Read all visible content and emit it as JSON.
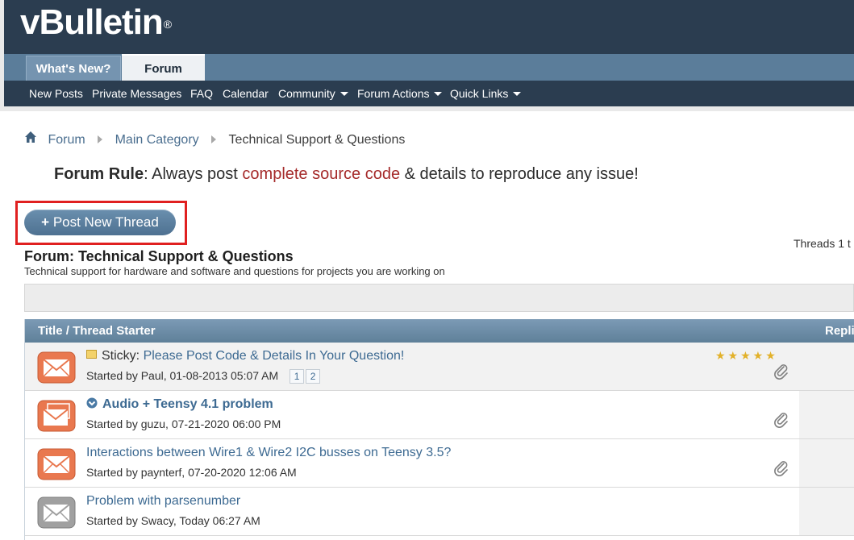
{
  "header": {
    "logo_text": "vBulletin",
    "logo_reg": "®",
    "tabs": [
      {
        "label": "What's New?"
      },
      {
        "label": "Forum"
      }
    ],
    "nav": {
      "new_posts": "New Posts",
      "private_messages": "Private Messages",
      "faq": "FAQ",
      "calendar": "Calendar",
      "community": "Community",
      "forum_actions": "Forum Actions",
      "quick_links": "Quick Links"
    }
  },
  "breadcrumb": {
    "items": [
      "Forum",
      "Main Category",
      "Technical Support & Questions"
    ]
  },
  "forum_rule": {
    "label": "Forum Rule",
    "pre": ": Always post ",
    "highlight": "complete source code",
    "post": " & details to reproduce any issue!"
  },
  "post_button": {
    "label": "Post New Thread"
  },
  "threads_count": "Threads 1 t",
  "forum": {
    "title": "Forum: Technical Support & Questions",
    "description": "Technical support for hardware and software and questions for projects you are working on"
  },
  "table": {
    "col_title": "Title / Thread Starter",
    "col_replies": "Repli"
  },
  "threads": [
    {
      "prefix": "Sticky:",
      "title": "Please Post Code & Details In Your Question!",
      "starter": "Started by Paul, 01-08-2013 05:07 AM",
      "pages": [
        "1",
        "2"
      ],
      "stars": "★★★★★"
    },
    {
      "title": "Audio + Teensy 4.1 problem",
      "starter": "Started by guzu, 07-21-2020 06:00 PM"
    },
    {
      "title": "Interactions between Wire1 & Wire2 I2C busses on Teensy 3.5?",
      "starter": "Started by paynterf, 07-20-2020 12:06 AM"
    },
    {
      "title": "Problem with parsenumber",
      "starter": "Started by Swacy, Today 06:27 AM"
    }
  ],
  "colors": {
    "header_dark": "#2b3d50",
    "tabbar": "#5b7d9a",
    "link": "#3d6a92",
    "rule_highlight": "#a52a2a",
    "annotation_outline": "#e02020",
    "envelope_hot": "#e9784f",
    "envelope_cold": "#9a9a9a"
  }
}
